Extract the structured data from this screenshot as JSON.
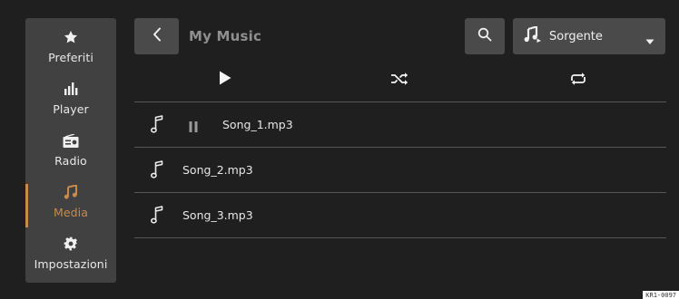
{
  "sidebar": {
    "items": [
      {
        "label": "Preferiti",
        "icon": "star-icon"
      },
      {
        "label": "Player",
        "icon": "equalizer-icon"
      },
      {
        "label": "Radio",
        "icon": "radio-icon"
      },
      {
        "label": "Media",
        "icon": "music-note-icon",
        "active": true
      },
      {
        "label": "Impostazioni",
        "icon": "gear-icon"
      }
    ]
  },
  "header": {
    "title": "My Music",
    "source_label": "Sorgente"
  },
  "tracks": [
    {
      "name": "Song_1.mp3",
      "playing": true
    },
    {
      "name": "Song_2.mp3"
    },
    {
      "name": "Song_3.mp3"
    }
  ],
  "footer": {
    "code": "KR1-0097"
  },
  "colors": {
    "background": "#1f1f1f",
    "panel": "#414141",
    "button": "#4a4a4a",
    "accent": "#c98a4b",
    "text": "#e8e8e8",
    "title": "#8f8f8f"
  }
}
